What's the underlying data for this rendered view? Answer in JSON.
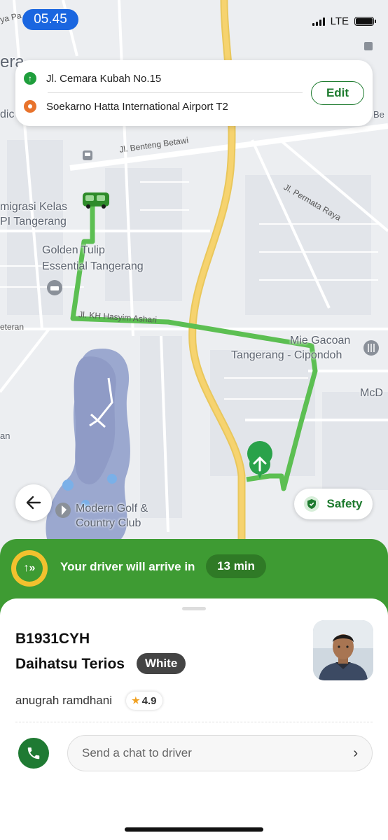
{
  "status_bar": {
    "time": "05.45",
    "network": "LTE"
  },
  "route": {
    "pickup": "Jl. Cemara Kubah No.15",
    "destination": "Soekarno Hatta International Airport T2",
    "edit_label": "Edit"
  },
  "map": {
    "labels": {
      "imigrasi": "migrasi Kelas",
      "imigrasi2": "PI Tangerang",
      "golden1": "Golden Tulip",
      "golden2": "Essential Tangerang",
      "mie1": "Mie Gacoan",
      "mie2": "Tangerang - Cipondoh",
      "mcd": "McD",
      "golf1": "Modern Golf &",
      "golf2": "Country Club",
      "era": "era",
      "dic": "dic",
      "an": "an",
      "be": "Be",
      "ya_pa": "ya Pa"
    },
    "streets": {
      "benteng": "Jl. Benteng Betawi",
      "permata": "Jl. Permata Raya",
      "hasyim": "Jl. KH Hasyim Ashari",
      "veteran": "eteran"
    }
  },
  "controls": {
    "back_icon": "arrow-left-icon",
    "safety_label": "Safety"
  },
  "banner": {
    "text": "Your driver will arrive in",
    "eta": "13 min"
  },
  "driver": {
    "plate": "B1931CYH",
    "car_model": "Daihatsu Terios",
    "car_color": "White",
    "name": "anugrah ramdhani",
    "rating": "4.9"
  },
  "chat": {
    "placeholder": "Send a chat to driver"
  },
  "colors": {
    "accent_green": "#3e9b33",
    "route_green": "#5cbf52",
    "highway": "#f6d36f"
  }
}
